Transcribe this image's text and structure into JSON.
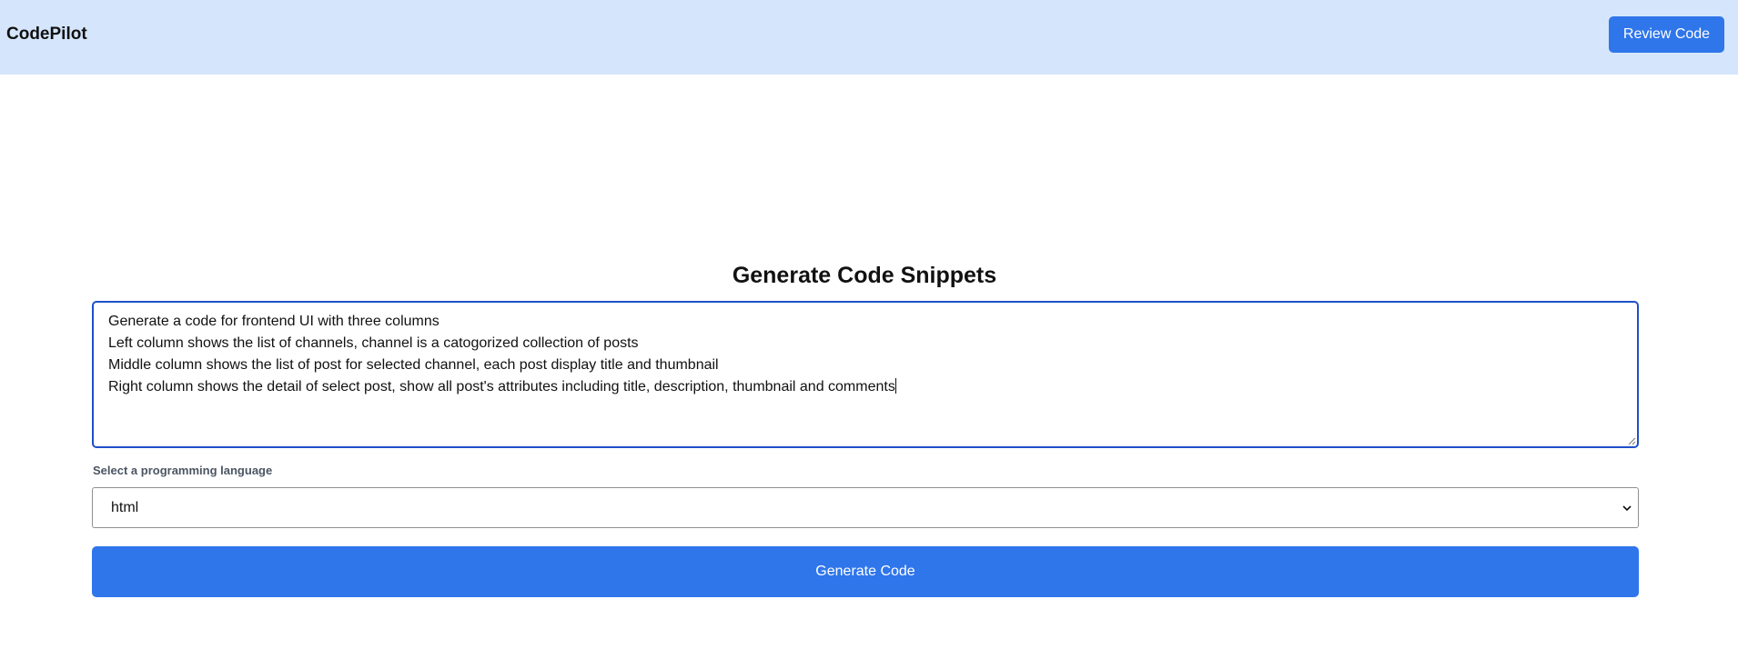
{
  "header": {
    "brand": "CodePilot",
    "review_button": "Review Code"
  },
  "main": {
    "title": "Generate Code Snippets",
    "prompt": {
      "lines": [
        "Generate a code for frontend UI with three columns",
        "Left column shows the list of channels, channel is a catogorized collection of posts",
        "Middle column shows the list of post for selected channel, each post display title and thumbnail",
        "Right column shows the detail of select post, show all post's attributes including title, description, thumbnail and comments"
      ]
    },
    "language": {
      "label": "Select a programming language",
      "selected": "html"
    },
    "generate_button": "Generate Code"
  },
  "colors": {
    "header_bg": "#d5e6fc",
    "accent": "#2f76eb",
    "focus_border": "#1f4fc8"
  },
  "icons": {
    "select_chevron": "chevron-down-icon",
    "resize_grip": "resize-grip-icon"
  }
}
